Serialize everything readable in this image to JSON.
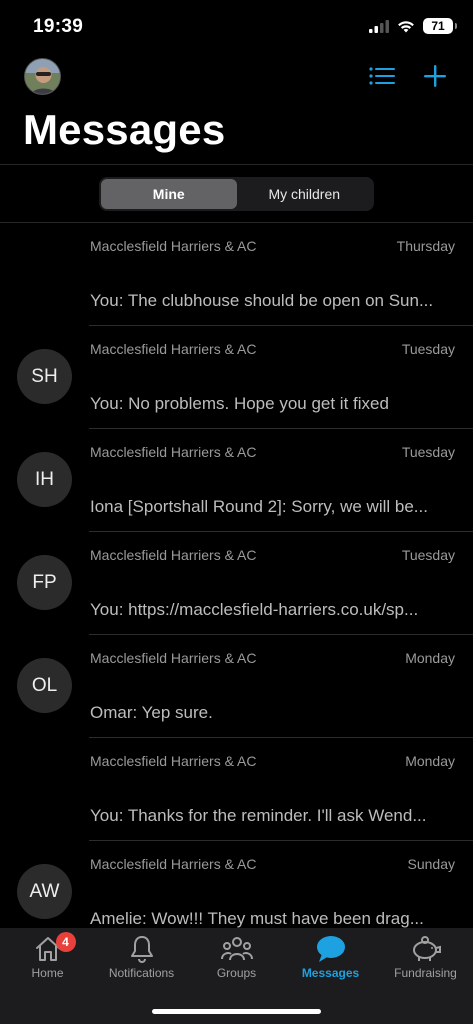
{
  "status_bar": {
    "time": "19:39",
    "battery": "71"
  },
  "header": {
    "title": "Messages",
    "list_icon": "list-icon",
    "add_icon": "plus-icon"
  },
  "segments": [
    {
      "label": "Mine",
      "active": true
    },
    {
      "label": "My children",
      "active": false
    }
  ],
  "messages": [
    {
      "group": "Macclesfield Harriers & AC",
      "day": "Thursday",
      "preview": "You: The clubhouse should be open on Sun...",
      "initials": ""
    },
    {
      "group": "Macclesfield Harriers & AC",
      "day": "Tuesday",
      "preview": "You: No problems. Hope you get it fixed",
      "initials": "SH"
    },
    {
      "group": "Macclesfield Harriers & AC",
      "day": "Tuesday",
      "preview": "Iona [Sportshall Round 2]: Sorry, we will be...",
      "initials": "IH"
    },
    {
      "group": "Macclesfield Harriers & AC",
      "day": "Tuesday",
      "preview": "You: https://macclesfield-harriers.co.uk/sp...",
      "initials": "FP"
    },
    {
      "group": "Macclesfield Harriers & AC",
      "day": "Monday",
      "preview": "Omar: Yep sure.",
      "initials": "OL"
    },
    {
      "group": "Macclesfield Harriers & AC",
      "day": "Monday",
      "preview": "You: Thanks for the reminder. I'll ask Wend...",
      "initials": "AW"
    },
    {
      "group": "Macclesfield Harriers & AC",
      "day": "Sunday",
      "preview": "Amelie: Wow!!!  They must have been drag...",
      "initials": ""
    }
  ],
  "tabbar": {
    "home": {
      "label": "Home",
      "badge": "4",
      "icon": "house-icon"
    },
    "notifications": {
      "label": "Notifications",
      "icon": "bell-icon"
    },
    "groups": {
      "label": "Groups",
      "icon": "people-icon"
    },
    "messages": {
      "label": "Messages",
      "icon": "chat-bubble-icon"
    },
    "fundraising": {
      "label": "Fundraising",
      "icon": "piggy-bank-icon"
    }
  },
  "colors": {
    "accent": "#1da1e0",
    "badge": "#e8403a",
    "background": "#000000"
  }
}
